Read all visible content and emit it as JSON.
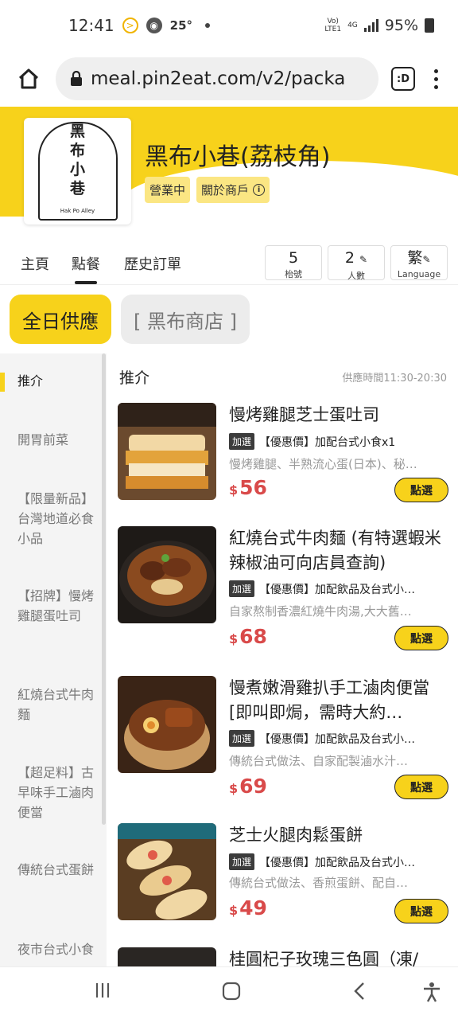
{
  "status": {
    "time": "12:41",
    "temp": "25°",
    "net_top": "Vo)",
    "net_bottom": "LTE1",
    "sig": "4G",
    "battery": "95%"
  },
  "browser": {
    "url": "meal.pin2eat.com/v2/packa",
    "tabs_label": ":D"
  },
  "store": {
    "title": "黑布小巷(荔枝角)",
    "status_chip": "營業中",
    "about_chip": "關於商戶",
    "logo_lines": [
      "黑",
      "布",
      "小",
      "巷"
    ],
    "logo_sub": "Hak Po Alley"
  },
  "nav": {
    "tabs": [
      "主頁",
      "點餐",
      "歷史訂單"
    ],
    "table_no": "5",
    "table_label": "枱號",
    "people": "2",
    "people_label": "人數",
    "lang": "繁",
    "lang_label": "Language"
  },
  "categories": [
    "全日供應",
    "[ 黑布商店 ]"
  ],
  "sidebar": {
    "items": [
      "推介",
      "開胃前菜",
      "【限量新品】台灣地道必食小品",
      "【招牌】慢烤雞腿蛋吐司",
      "紅燒台式牛肉麵",
      "【超足料】古早味手工滷肉便當",
      "傳統台式蛋餅",
      "夜市台式小食"
    ]
  },
  "list": {
    "heading": "推介",
    "hours": "供應時間11:30-20:30",
    "order_label": "點選",
    "currency": "$",
    "items": [
      {
        "name": "慢烤雞腿芝士蛋吐司",
        "tag": "加選",
        "promo": "【優惠價】加配台式小食x1",
        "desc": "慢烤雞腿、半熟流心蛋(日本)、秘…",
        "price": "56"
      },
      {
        "name": "紅燒台式牛肉麵 (有特選蝦米辣椒油可向店員查詢)",
        "tag": "加選",
        "promo": "【優惠價】加配飲品及台式小…",
        "desc": "自家熬制香濃紅燒牛肉湯,大大舊…",
        "price": "68"
      },
      {
        "name": "慢煮嫩滑雞扒手工滷肉便當 [即叫即焗，需時大約…",
        "tag": "加選",
        "promo": "【優惠價】加配飲品及台式小…",
        "desc": "傳統台式做法、自家配製滷水汁…",
        "price": "69"
      },
      {
        "name": "芝士火腿肉鬆蛋餅",
        "tag": "加選",
        "promo": "【優惠價】加配飲品及台式小…",
        "desc": "傳統台式做法、香煎蛋餅、配自…",
        "price": "49"
      },
      {
        "name": "桂圓杞子玫瑰三色圓（凍/",
        "tag": "",
        "promo": "",
        "desc": "",
        "price": ""
      }
    ]
  },
  "colors": {
    "brand_yellow": "#f7d21b",
    "price_red": "#d94a4a"
  }
}
